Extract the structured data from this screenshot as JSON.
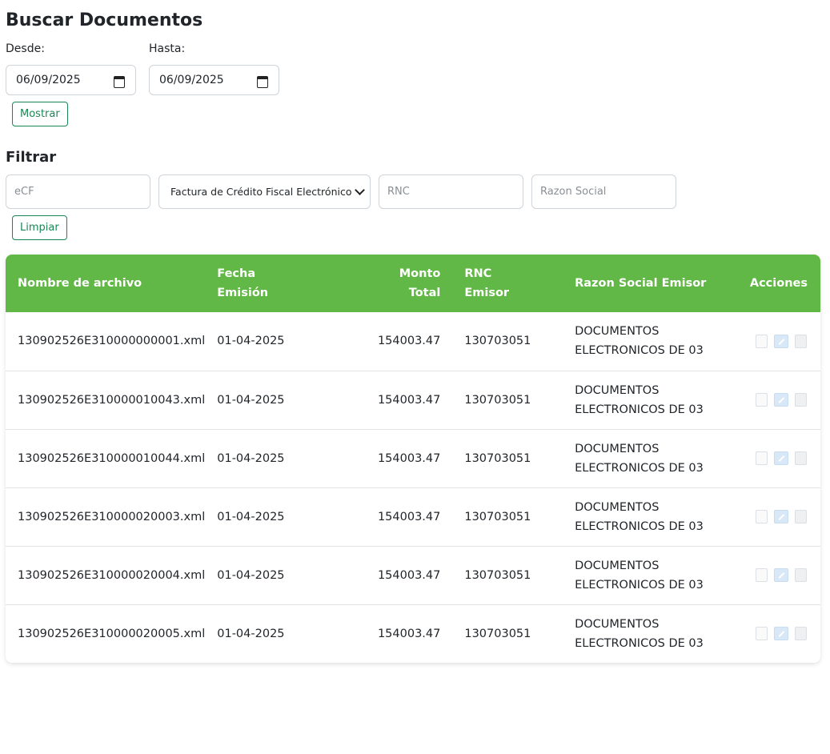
{
  "page": {
    "title": "Buscar Documentos"
  },
  "range": {
    "desde_label": "Desde:",
    "hasta_label": "Hasta:",
    "desde_value": "06/09/2025",
    "hasta_value": "06/09/2025",
    "mostrar_label": "Mostrar"
  },
  "filter": {
    "title": "Filtrar",
    "ecf_placeholder": "eCF",
    "tipo_selected": "Factura de Crédito Fiscal Electrónico",
    "rnc_placeholder": "RNC",
    "razon_placeholder": "Razon Social",
    "limpiar_label": "Limpiar"
  },
  "table": {
    "headers": [
      "Nombre de archivo",
      "Fecha Emisión",
      "Monto Total",
      "RNC Emisor",
      "Razon Social Emisor",
      "Acciones"
    ],
    "rows": [
      [
        "130902526E310000000001.xml",
        "01-04-2025",
        "154003.47",
        "130703051",
        "DOCUMENTOS ELECTRONICOS DE 03"
      ],
      [
        "130902526E310000010043.xml",
        "01-04-2025",
        "154003.47",
        "130703051",
        "DOCUMENTOS ELECTRONICOS DE 03"
      ],
      [
        "130902526E310000010044.xml",
        "01-04-2025",
        "154003.47",
        "130703051",
        "DOCUMENTOS ELECTRONICOS DE 03"
      ],
      [
        "130902526E310000020003.xml",
        "01-04-2025",
        "154003.47",
        "130703051",
        "DOCUMENTOS ELECTRONICOS DE 03"
      ],
      [
        "130902526E310000020004.xml",
        "01-04-2025",
        "154003.47",
        "130703051",
        "DOCUMENTOS ELECTRONICOS DE 03"
      ],
      [
        "130902526E310000020005.xml",
        "01-04-2025",
        "154003.47",
        "130703051",
        "DOCUMENTOS ELECTRONICOS DE 03"
      ]
    ],
    "action_icons": [
      "document-icon",
      "edit-icon",
      "pdf-icon"
    ]
  },
  "colors": {
    "header_bg": "#62b846",
    "button_accent": "#198754"
  }
}
